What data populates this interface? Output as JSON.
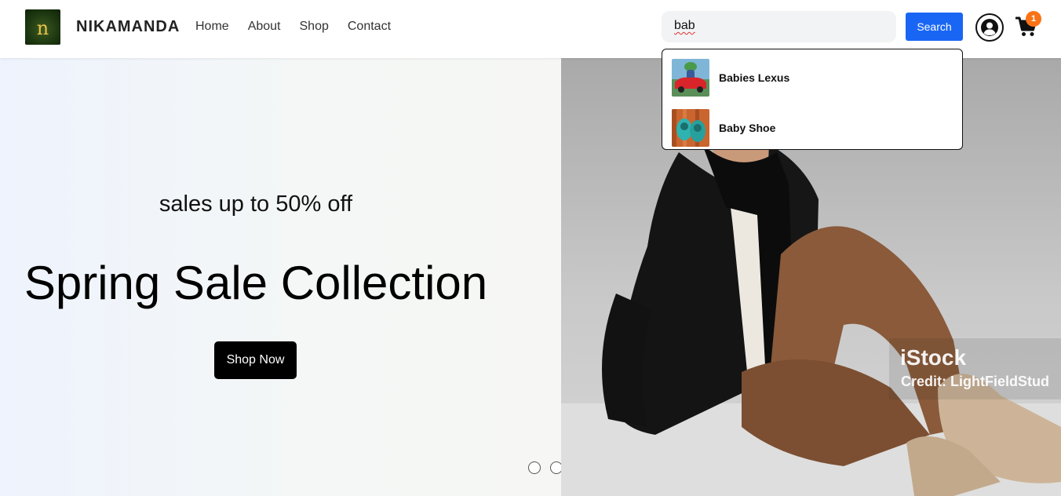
{
  "header": {
    "logo_letter": "n",
    "brand": "NIKAMANDA",
    "nav": [
      "Home",
      "About",
      "Shop",
      "Contact"
    ],
    "search": {
      "value": "bab",
      "placeholder": ""
    },
    "search_button": "Search",
    "cart_count": "1",
    "icons": {
      "account": "user-circle-icon",
      "cart": "shopping-cart-icon"
    }
  },
  "suggestions": [
    {
      "label": "Babies Lexus",
      "thumb": "red toy car photo"
    },
    {
      "label": "Baby Shoe",
      "thumb": "teal baby shoes photo"
    }
  ],
  "hero": {
    "subtitle": "sales up to 50% off",
    "title": "Spring Sale Collection",
    "cta": "Shop Now",
    "watermark": {
      "logo": "iStock",
      "credit": "Credit: LightFieldStud"
    },
    "carousel": {
      "count": 3,
      "active_index": 2
    }
  },
  "colors": {
    "accent": "#1966f5",
    "badge": "#f97316",
    "cta_bg": "#000000"
  }
}
